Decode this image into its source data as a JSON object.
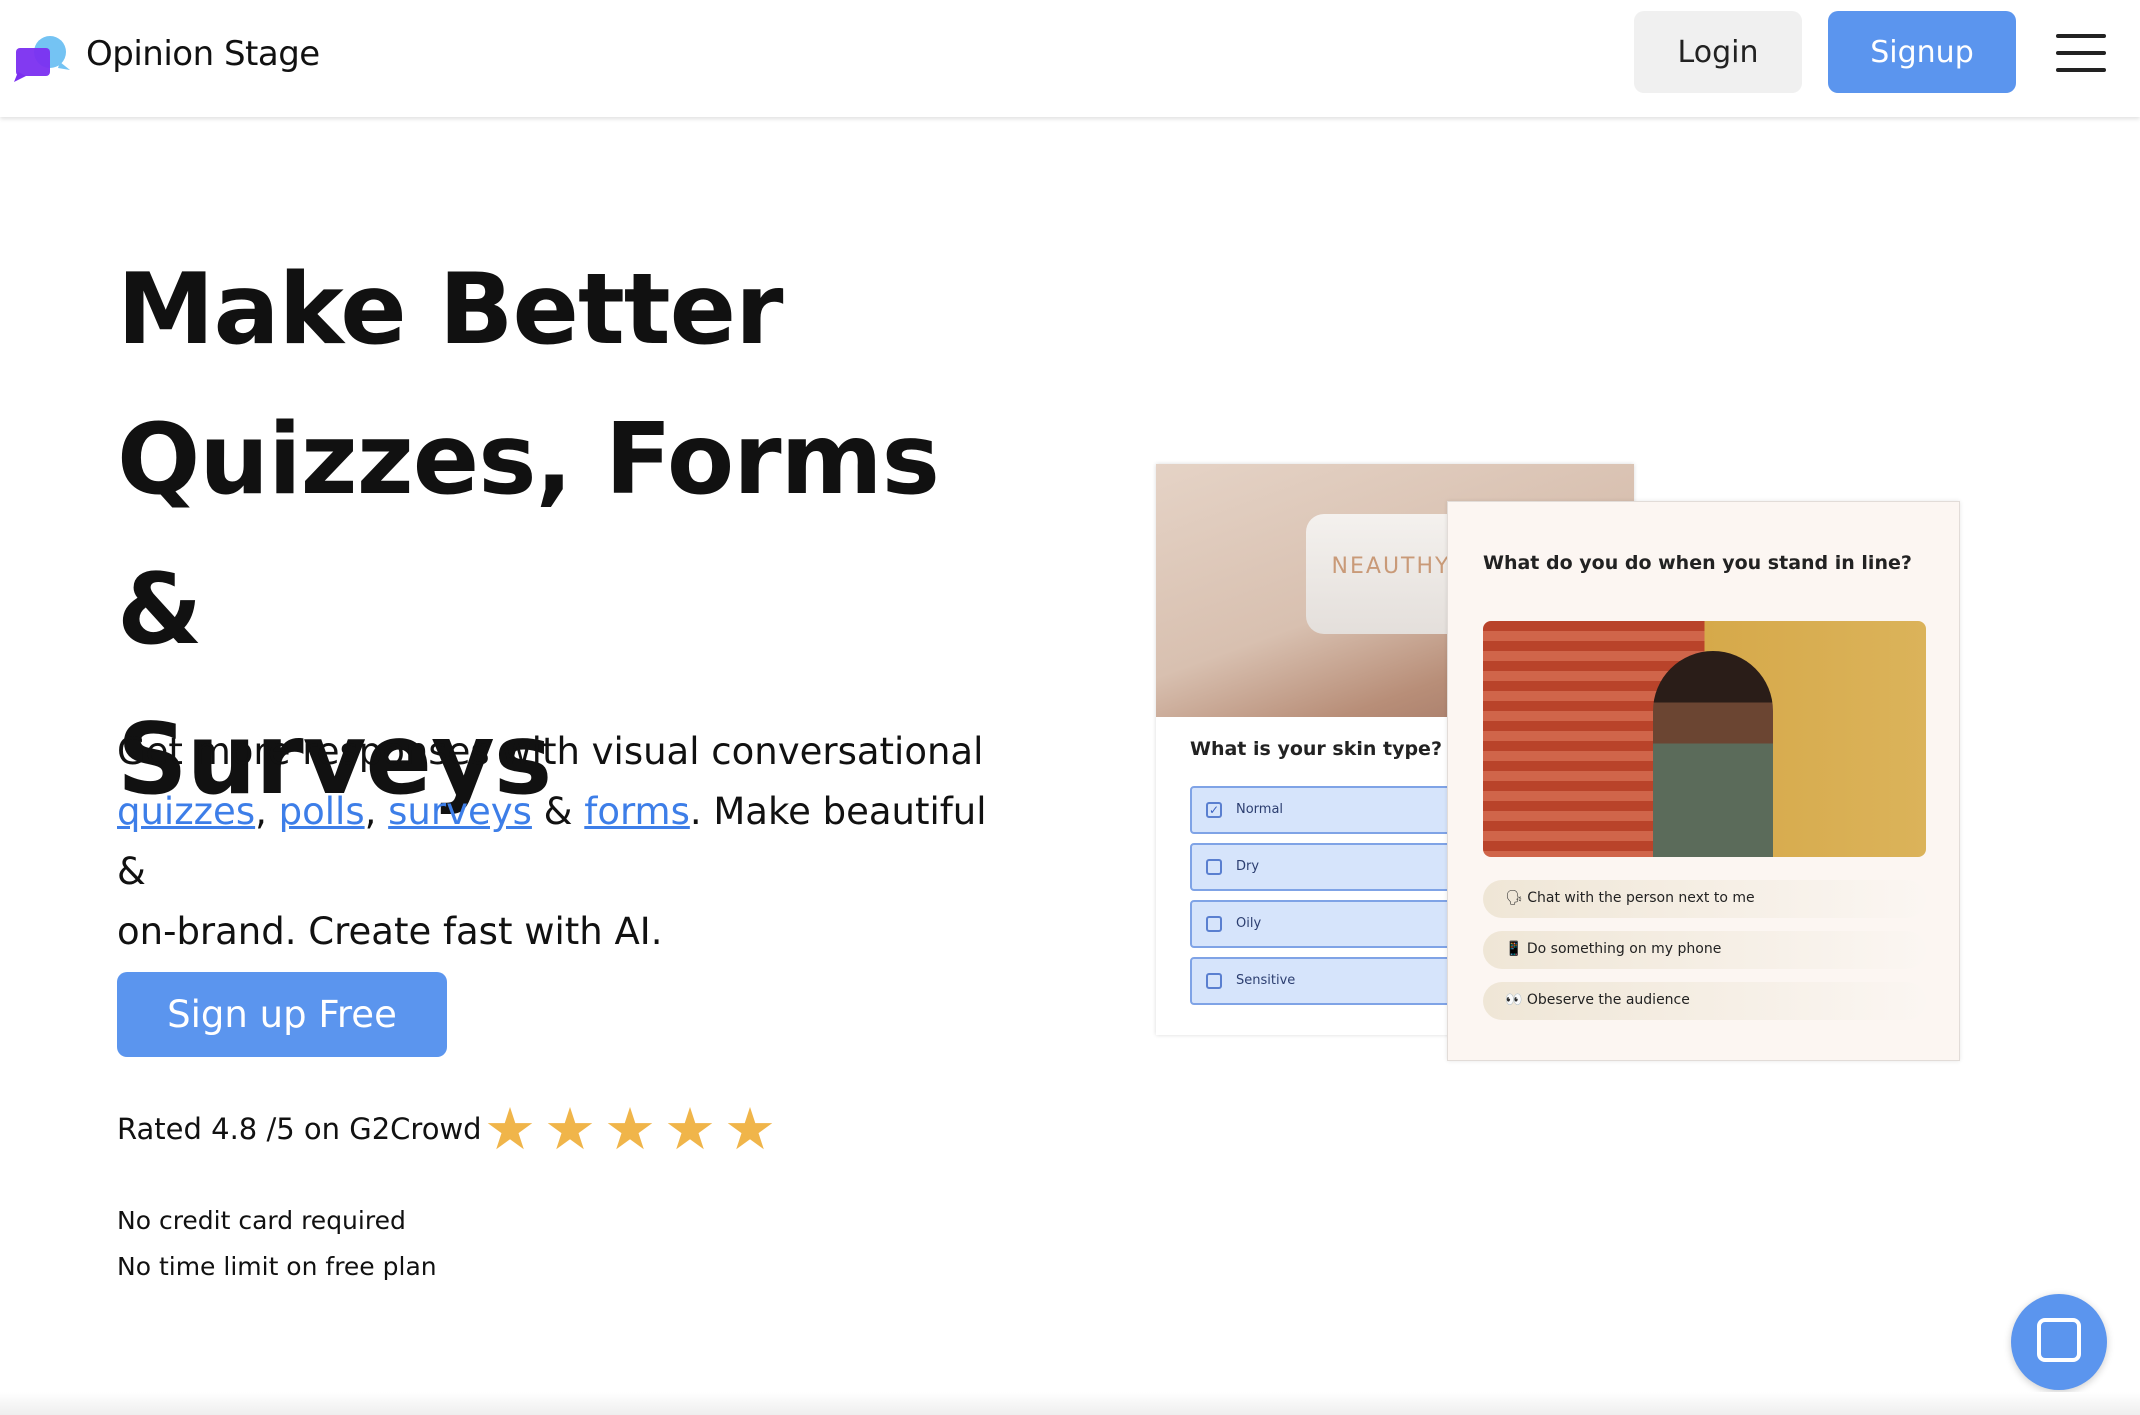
{
  "header": {
    "brand": "Opinion Stage",
    "login": "Login",
    "signup": "Signup"
  },
  "hero": {
    "title_lines": [
      "Make Better",
      "Quizzes, Forms &",
      "Surveys"
    ],
    "lead_1": "Get more responses with visual conversational",
    "links": [
      "quizzes",
      "polls",
      "surveys",
      "forms"
    ],
    "sep_comma": ", ",
    "sep_amp": " & ",
    "lead_2": ". Make beautiful &",
    "lead_3": "on-brand. Create fast with AI.",
    "cta": "Sign up Free",
    "rating": "Rated 4.8 /5 on G2Crowd",
    "rating_value": 4.8,
    "stars": "★★★★★",
    "notes": [
      "No credit card required",
      "No time limit on free plan"
    ]
  },
  "card1": {
    "brand_text": "NEAUTHY",
    "question": "What is your skin type?",
    "options": [
      {
        "label": "Normal",
        "checked": true
      },
      {
        "label": "Dry",
        "checked": false
      },
      {
        "label": "Oily",
        "checked": false
      },
      {
        "label": "Sensitive",
        "checked": false
      }
    ],
    "check": "✓"
  },
  "card2": {
    "question": "What do you do when you stand in line?",
    "answers": [
      "🗣 Chat with the person next to me",
      "📱 Do something on my phone",
      "👀 Obeserve the audience"
    ]
  },
  "colors": {
    "accent": "#5b95ee",
    "link": "#3d7ee8",
    "star": "#f0b54a"
  }
}
